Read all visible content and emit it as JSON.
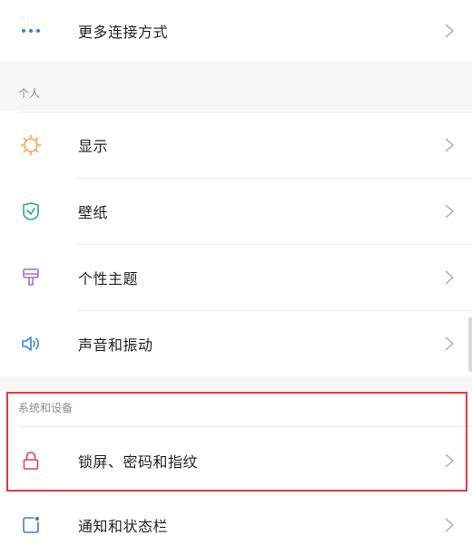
{
  "rows": {
    "more_connections": {
      "label": "更多连接方式",
      "icon": "more-dots-icon"
    },
    "display": {
      "label": "显示",
      "icon": "sun-icon"
    },
    "wallpaper": {
      "label": "壁纸",
      "icon": "wallpaper-icon"
    },
    "theme": {
      "label": "个性主题",
      "icon": "brush-icon"
    },
    "sound": {
      "label": "声音和振动",
      "icon": "speaker-icon"
    },
    "lockscreen": {
      "label": "锁屏、密码和指纹",
      "icon": "lock-icon"
    },
    "notifications": {
      "label": "通知和状态栏",
      "icon": "notification-icon"
    }
  },
  "sections": {
    "personal": "个人",
    "system": "系统和设备"
  },
  "colors": {
    "accent_blue": "#2f7fe6",
    "sun_orange": "#f0a24a",
    "wallpaper_teal": "#2aa7a0",
    "theme_purple": "#a46ad6",
    "sound_blue": "#3a87d8",
    "lock_red": "#d9405a",
    "notify_blue": "#3a7fd8",
    "highlight_red": "#e03a3e"
  }
}
